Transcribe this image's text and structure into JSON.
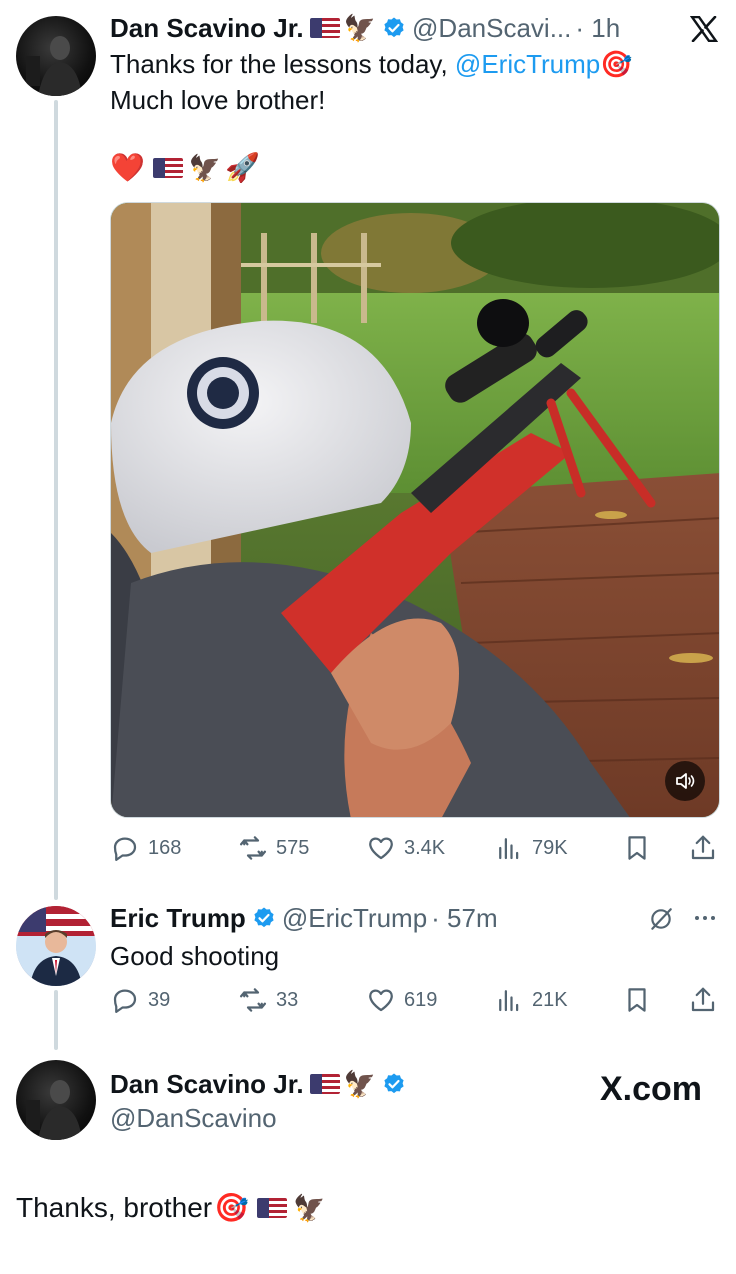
{
  "tweet1": {
    "name": "Dan Scavino Jr.",
    "handle": "@DanScavi...",
    "time": "· 1h",
    "text_line1": "Thanks for the lessons today, ",
    "mention": "@EricTrump",
    "text_line2": "Much love brother!",
    "emoji_line": "❤️",
    "stats": {
      "replies": "168",
      "reposts": "575",
      "likes": "3.4K",
      "views": "79K"
    }
  },
  "tweet2": {
    "name": "Eric Trump",
    "handle": "@EricTrump",
    "time": "· 57m",
    "text": "Good shooting",
    "stats": {
      "replies": "39",
      "reposts": "33",
      "likes": "619",
      "views": "21K"
    }
  },
  "tweet3": {
    "name": "Dan Scavino Jr.",
    "handle": "@DanScavino",
    "brand": "X.com",
    "text": "Thanks, brother"
  },
  "icons": [
    "x-logo-icon",
    "verified-icon",
    "reply-icon",
    "repost-icon",
    "like-icon",
    "views-icon",
    "bookmark-icon",
    "share-icon",
    "mute-icon",
    "grok-icon",
    "more-icon"
  ],
  "colors": {
    "accent": "#1d9bf0",
    "muted": "#536471",
    "text": "#0f1419",
    "thread_line": "#cfd9de"
  }
}
